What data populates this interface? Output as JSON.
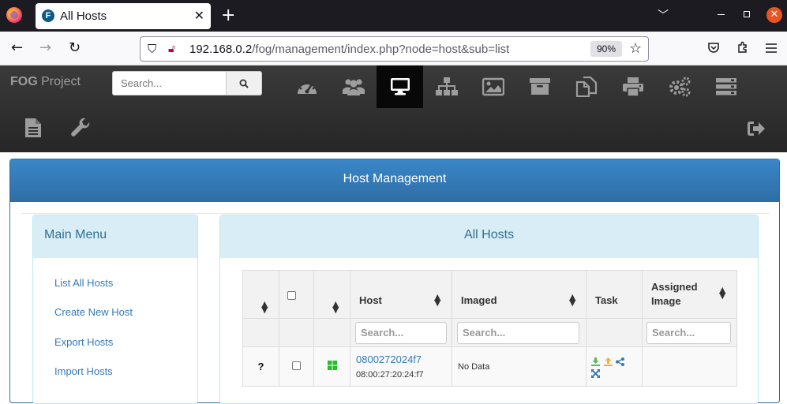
{
  "browser": {
    "tab_title": "All Hosts",
    "tab_favicon_letter": "F",
    "new_tab": "+",
    "url_host": "192.168.0.2",
    "url_path": "/fog/management/index.php?node=host&sub=list",
    "zoom": "90%"
  },
  "header": {
    "brand_bold": "FOG",
    "brand_rest": " Project",
    "search_placeholder": "Search...",
    "menu_icons": [
      "dashboard-icon",
      "users-icon",
      "hosts-icon",
      "groups-icon",
      "images-icon",
      "storage-icon",
      "snapins-icon",
      "printers-icon",
      "settings-icon",
      "tasks-icon",
      "reports-icon",
      "plugins-icon",
      "logout-icon"
    ]
  },
  "page": {
    "title": "Host Management"
  },
  "sidebar": {
    "title": "Main Menu",
    "items": [
      "List All Hosts",
      "Create New Host",
      "Export Hosts",
      "Import Hosts"
    ]
  },
  "main": {
    "title": "All Hosts",
    "columns": [
      "Host",
      "Imaged",
      "Task",
      "Assigned Image"
    ],
    "assigned_line1": "Assigned",
    "assigned_line2": "Image",
    "filter_placeholder": "Search...",
    "rows": [
      {
        "status": "?",
        "name": "0800272024f7",
        "mac": "08:00:27:20:24:f7",
        "imaged": "No Data",
        "os_icon": "windows-icon",
        "task_icons": [
          "deploy-icon",
          "capture-icon",
          "multicast-icon",
          "advanced-icon"
        ]
      }
    ]
  },
  "colors": {
    "header_bg": "#262626",
    "panel_blue": "#2e6da4",
    "panel_info_bg": "#d9edf7",
    "link": "#337ab7",
    "windows_green": "#22c02a",
    "task_green": "#5cb85c",
    "task_orange": "#f0ad4e"
  }
}
